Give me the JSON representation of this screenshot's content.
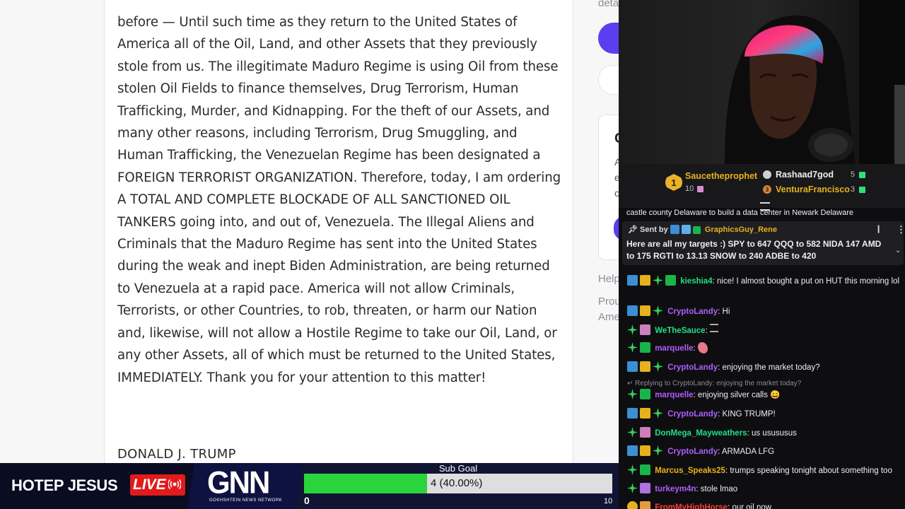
{
  "post": {
    "text": "before — Until such time as they return to the United States of America all of the Oil, Land, and other Assets that they previously stole from us. The illegitimate Maduro Regime is using Oil from these stolen Oil Fields to finance themselves, Drug Terrorism, Human Trafficking, Murder, and Kidnapping. For the theft of our Assets, and many other reasons, including Terrorism, Drug Smuggling, and Human Trafficking, the Venezuelan Regime has been designated a FOREIGN TERRORIST ORGANIZATION. Therefore, today, I am ordering A TOTAL AND COMPLETE BLOCKADE OF ALL SANCTIONED OIL TANKERS going into, and out of, Venezuela. The Illegal Aliens and Criminals that the Maduro Regime has sent into the United States during the weak and inept Biden Administration, are being returned to Venezuela at a rapid pace. America will not allow Criminals, Terrorists, or other Countries, to rob, threaten, or harm our Nation and, likewise, will not allow a Hostile Regime to take our Oil, Land, or any other Assets, all of which must be returned to the United States, IMMEDIATELY. Thank you for your attention to this matter!",
    "signature": "DONALD J. TRUMP"
  },
  "right_panel": {
    "top_text": "deta",
    "help": "Help",
    "prou": "Prou",
    "ame": "Ame",
    "card_initial": "C",
    "card_line1": "A",
    "card_line2": "e",
    "card_line3": "c"
  },
  "leaderboard": {
    "first": {
      "rank": "1",
      "name": "Saucetheprophet",
      "count": "10"
    },
    "second": {
      "name": "Rashaad7god",
      "count": "5"
    },
    "third": {
      "rank": "3",
      "name": "VenturaFrancisco",
      "count": "3"
    }
  },
  "chat": {
    "cut_message": "castle county Delaware to build a data center in Newark Delaware",
    "pinned": {
      "sent_by": "Sent by",
      "user": "GraphicsGuy_Rene",
      "text": "Here are all my targets :) SPY to 647 QQQ to 582 NIDA 147 AMD to 175 RGTI to 13.13 SNOW to 240 ADBE to 420"
    },
    "reply_context": "Replying to CryptoLandy: enjoying the market today?",
    "messages": [
      {
        "user": "kieshia4",
        "text": "nice! I almost bought a put on HUT this morning lol",
        "color": "#1fe089"
      },
      {
        "user": "CryptoLandy",
        "text": "Hi",
        "color": "#b05cff"
      },
      {
        "user": "WeTheSauce",
        "text": "",
        "color": "#1fe089"
      },
      {
        "user": "marquelle",
        "text": "",
        "color": "#b05cff"
      },
      {
        "user": "CryptoLandy",
        "text": "enjoying the market today?",
        "color": "#b05cff"
      },
      {
        "user": "marquelle",
        "text": "enjoying silver calls 😄",
        "color": "#b05cff"
      },
      {
        "user": "CryptoLandy",
        "text": "KING TRUMP!",
        "color": "#b05cff"
      },
      {
        "user": "DonMega_Mayweathers",
        "text": "us usususus",
        "color": "#1fe089"
      },
      {
        "user": "CryptoLandy",
        "text": "ARMADA LFG",
        "color": "#b05cff"
      },
      {
        "user": "Marcus_Speaks25",
        "text": "trumps speaking tonight about something too",
        "color": "#e6b21c"
      },
      {
        "user": "turkeym4n",
        "text": "stole lmao",
        "color": "#b05cff"
      },
      {
        "user": "FromMyHighHorse",
        "text": "our oil now",
        "color": "#ff3a3a"
      }
    ]
  },
  "bottom_bar": {
    "brand": "HOTEP JESUS",
    "live": "LIVE",
    "gnn": "GNN",
    "gnn_sub": "GOKHSHTEIN NEWS NETWORK",
    "goal_title": "Sub Goal",
    "goal_text": "4 (40.00%)",
    "goal_current": 4,
    "goal_target": 10,
    "goal_min": "0",
    "goal_max": "10"
  },
  "colors": {
    "accent_purple": "#5b3ef0",
    "goal_green": "#2bd33d",
    "live_red": "#e11b1b",
    "chat_bg": "#0e0e10"
  }
}
